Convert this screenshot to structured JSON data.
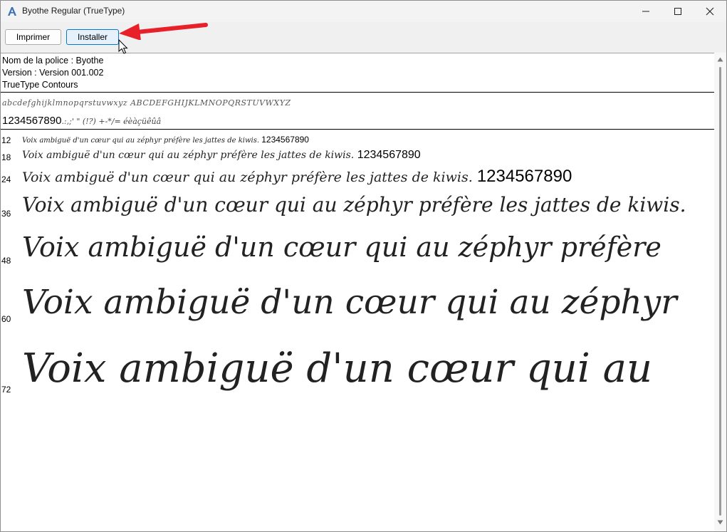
{
  "window": {
    "title": "Byothe Regular (TrueType)"
  },
  "toolbar": {
    "print_label": "Imprimer",
    "install_label": "Installer"
  },
  "info": {
    "name_line": "Nom de la police : Byothe",
    "version_line": "Version : Version 001.002",
    "type_line": "TrueType  Contours"
  },
  "charset": {
    "alphabet": "abcdefghijklmnopqrstuvwxyz ABCDEFGHIJKLMNOPQRSTUVWXYZ",
    "digits": "1234567890",
    "symbols": ".:,;' \" (!?) +-*/= éèàçüêûâ"
  },
  "samples": [
    {
      "size": "12",
      "text": "Voix ambiguë d'un cœur qui au zéphyr préfère les jattes de kiwis.",
      "digits": "1234567890"
    },
    {
      "size": "18",
      "text": "Voix ambiguë d'un cœur qui au zéphyr préfère les jattes de kiwis.",
      "digits": "1234567890"
    },
    {
      "size": "24",
      "text": "Voix ambiguë d'un cœur qui au zéphyr préfère les jattes de kiwis.",
      "digits": "1234567890"
    },
    {
      "size": "36",
      "text": "Voix ambiguë d'un cœur qui au zéphyr préfère les jattes de kiwis.",
      "digits": ""
    },
    {
      "size": "48",
      "text": "Voix ambiguë d'un cœur qui au zéphyr préfère",
      "digits": ""
    },
    {
      "size": "60",
      "text": "Voix ambiguë d'un cœur qui au zéphyr",
      "digits": ""
    },
    {
      "size": "72",
      "text": "Voix ambiguë d'un cœur qui au",
      "digits": ""
    }
  ],
  "colors": {
    "accent": "#0078d4",
    "annotation_arrow": "#e8202a"
  },
  "icons": {
    "app": "font-viewer-icon",
    "minimize": "minimize-icon",
    "maximize": "maximize-icon",
    "close": "close-icon",
    "annotation": "red-arrow-icon",
    "pointer": "mouse-cursor-icon"
  }
}
